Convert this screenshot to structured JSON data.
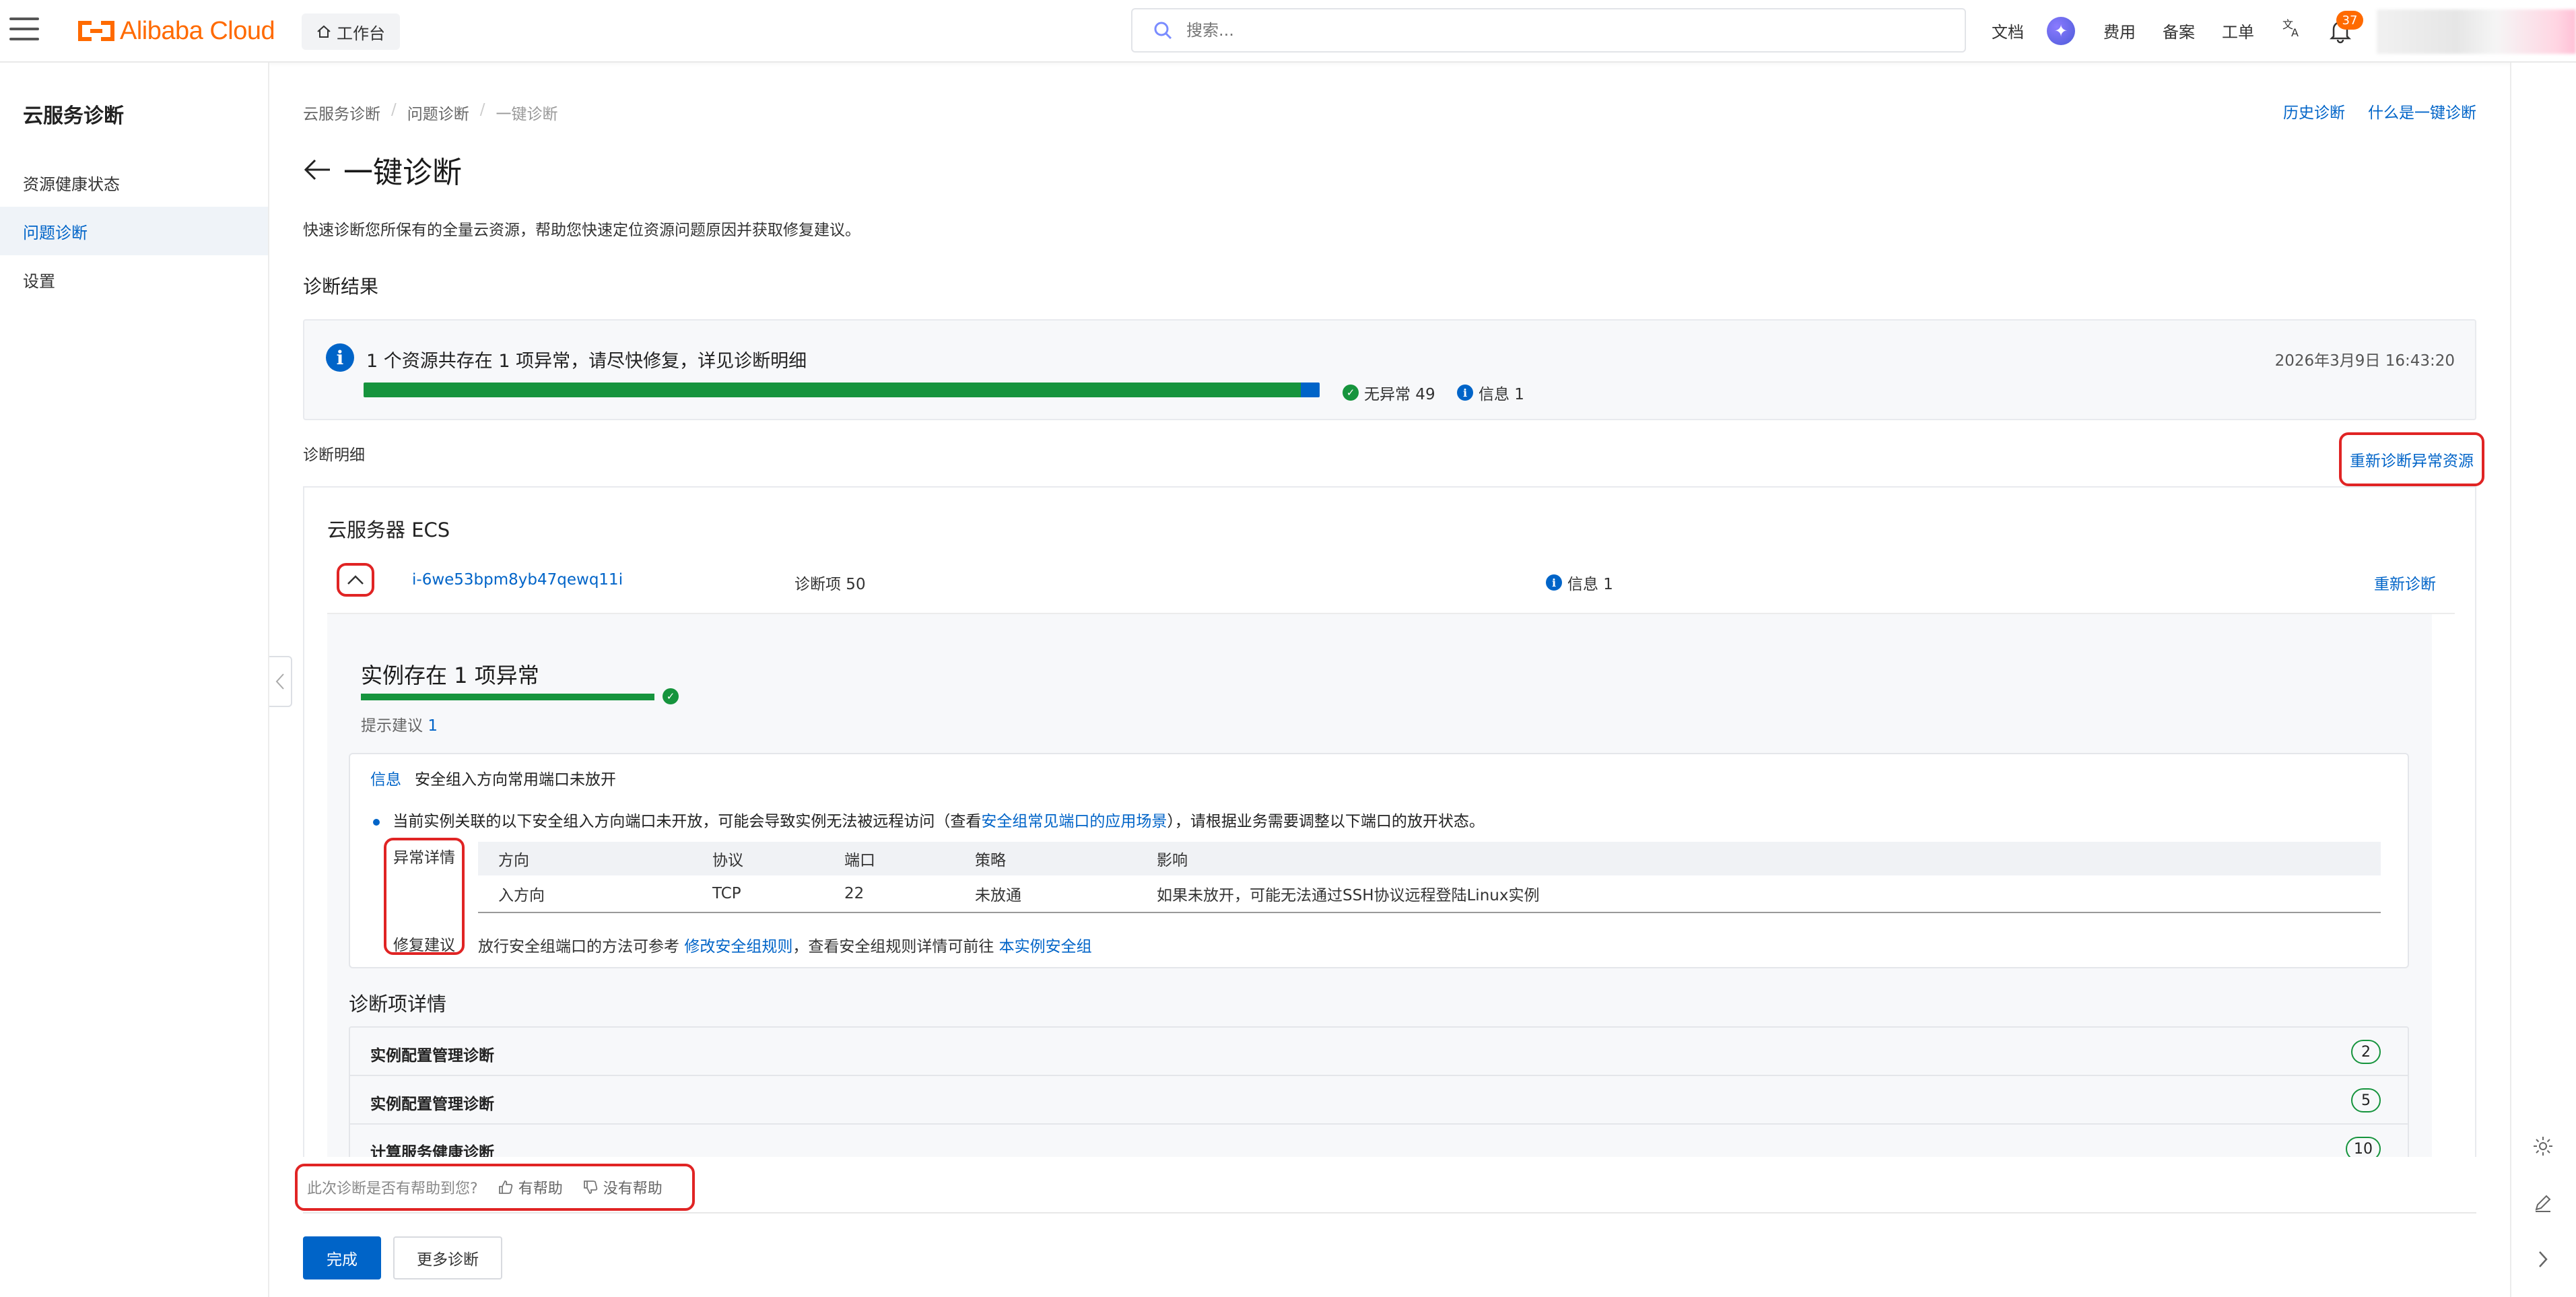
{
  "topbar": {
    "logo_text": "Alibaba Cloud",
    "workbench": "工作台",
    "search_placeholder": "搜索...",
    "nav": [
      "文档",
      "费用",
      "备案",
      "工单"
    ],
    "notification_count": "37"
  },
  "sidebar": {
    "title": "云服务诊断",
    "items": [
      {
        "label": "资源健康状态",
        "active": false
      },
      {
        "label": "问题诊断",
        "active": true
      },
      {
        "label": "设置",
        "active": false
      }
    ]
  },
  "breadcrumb": [
    "云服务诊断",
    "问题诊断",
    "一键诊断"
  ],
  "header_links": {
    "history": "历史诊断",
    "what_is": "什么是一键诊断"
  },
  "page": {
    "title": "一键诊断",
    "description": "快速诊断您所保有的全量云资源，帮助您快速定位资源问题原因并获取修复建议。",
    "result_section": "诊断结果"
  },
  "summary": {
    "message": "1 个资源共存在 1 项异常，请尽快修复，详见诊断明细",
    "timestamp": "2026年3月9日 16:43:20",
    "normal_label": "无异常 49",
    "info_label": "信息 1",
    "normal_count": 49,
    "info_count": 1
  },
  "detail": {
    "title": "诊断明细",
    "rediagnose_all": "重新诊断异常资源",
    "product": "云服务器 ECS",
    "instance_id": "i-6we53bpm8yb47qewq11i",
    "diag_count": "诊断项 50",
    "info": "信息 1",
    "rediagnose": "重新诊断"
  },
  "instance": {
    "title": "实例存在 1 项异常",
    "hint_label": "提示建议",
    "hint_count": "1",
    "issue": {
      "tag": "信息",
      "name": "安全组入方向常用端口未放开",
      "desc_before": "当前实例关联的以下安全组入方向端口未开放，可能会导致实例无法被远程访问（查看",
      "desc_link": "安全组常见端口的应用场景",
      "desc_after": "），请根据业务需要调整以下端口的放开状态。",
      "abnormal_label": "异常详情",
      "fix_label": "修复建议",
      "columns": [
        "方向",
        "协议",
        "端口",
        "策略",
        "影响"
      ],
      "rows": [
        [
          "入方向",
          "TCP",
          "22",
          "未放通",
          "如果未放开，可能无法通过SSH协议远程登陆Linux实例"
        ]
      ],
      "fix_before": "放行安全组端口的方法可参考 ",
      "fix_link1": "修改安全组规则",
      "fix_middle": "，查看安全组规则详情可前往 ",
      "fix_link2": "本实例安全组"
    }
  },
  "diag_items": {
    "title": "诊断项详情",
    "rows": [
      {
        "name": "实例配置管理诊断",
        "count": "2"
      },
      {
        "name": "实例配置管理诊断",
        "count": "5"
      },
      {
        "name": "计算服务健康诊断",
        "count": "10"
      }
    ]
  },
  "feedback": {
    "question": "此次诊断是否有帮助到您?",
    "yes": "有帮助",
    "no": "没有帮助"
  },
  "footer": {
    "done": "完成",
    "more": "更多诊断"
  },
  "colors": {
    "accent": "#0064c8",
    "brand": "#ff6a00",
    "success": "#16943d",
    "highlight": "#e02424"
  }
}
